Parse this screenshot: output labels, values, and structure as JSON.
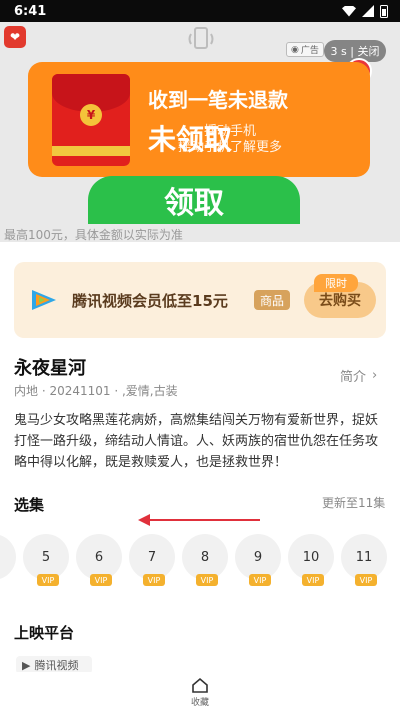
{
  "status_bar": {
    "time": "6:41",
    "icons": [
      "wifi-icon",
      "signal-icon",
      "battery-icon"
    ]
  },
  "ad": {
    "tag_label": "广告",
    "close_label": "3 s | 关闭",
    "badge_count": "3",
    "headline": "收到一笔未退款",
    "status": "未领取",
    "shake_hint_line1": "摇动手机",
    "shake_hint_line2": "摇动手机了解更多",
    "claim_label": "领取",
    "footnote": "最高100元，具体金额以实际为准",
    "accent_color": "#ff8c19"
  },
  "vip_banner": {
    "text": "腾讯视频会员低至15元",
    "chip_label": "商品",
    "limited_label": "限时",
    "buy_label": "去购买"
  },
  "show": {
    "title": "永夜星河",
    "meta": "内地 · 20241101 · ,爱情,古装",
    "intro_label": "简介",
    "description": "鬼马少女攻略黑莲花病娇，高燃集结闯关万物有爱新世界，捉妖打怪一路升级，缔结动人情谊。人、妖两族的宿世仇怨在任务攻略中得以化解，既是救赎爱人，也是拯救世界！"
  },
  "episodes": {
    "section_title": "选集",
    "update_status": "更新至11集",
    "items": [
      {
        "num": "",
        "vip": ""
      },
      {
        "num": "5",
        "vip": "VIP"
      },
      {
        "num": "6",
        "vip": "VIP"
      },
      {
        "num": "7",
        "vip": "VIP"
      },
      {
        "num": "8",
        "vip": "VIP"
      },
      {
        "num": "9",
        "vip": "VIP"
      },
      {
        "num": "10",
        "vip": "VIP"
      },
      {
        "num": "11",
        "vip": "VIP"
      }
    ]
  },
  "platforms": {
    "section_title": "上映平台",
    "items": [
      {
        "name": "腾讯视频"
      }
    ]
  },
  "bottom_bar": {
    "favorite_label": "收藏"
  }
}
